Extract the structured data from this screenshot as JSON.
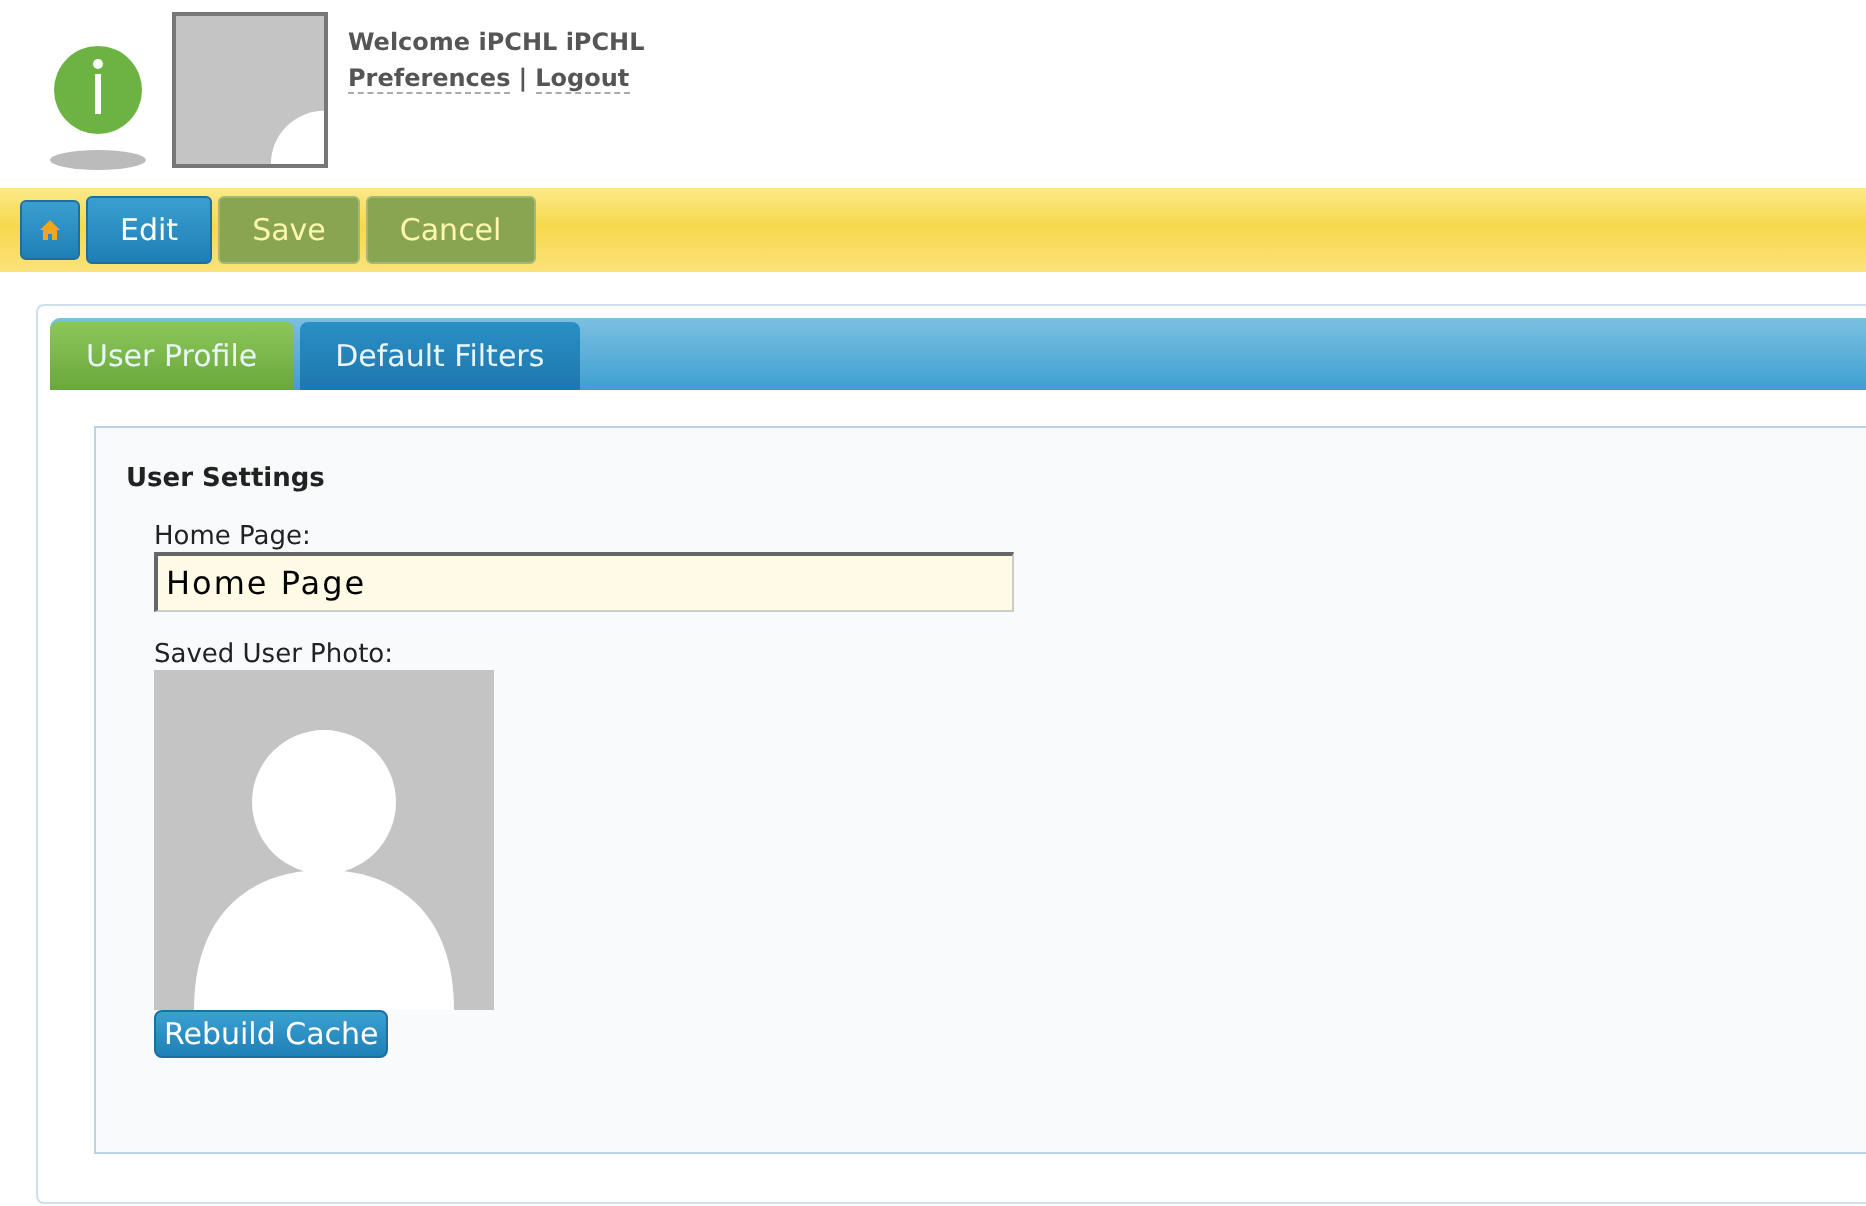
{
  "header": {
    "welcome": "Welcome iPCHL iPCHL",
    "links": [
      {
        "label": "Preferences"
      },
      {
        "label": "Logout"
      }
    ],
    "separator": "|"
  },
  "toolbar": {
    "buttons": [
      {
        "kind": "home",
        "disabled": false
      },
      {
        "kind": "text",
        "label": "Edit",
        "disabled": false
      },
      {
        "kind": "text",
        "label": "Save",
        "disabled": true
      },
      {
        "kind": "text",
        "label": "Cancel",
        "disabled": true
      }
    ]
  },
  "tabs": [
    {
      "label": "User Profile",
      "selected": true
    },
    {
      "label": "Default Filters",
      "selected": false
    }
  ],
  "section": {
    "title": "User Settings",
    "home_page": {
      "label": "Home Page:",
      "value": "Home Page"
    },
    "photo": {
      "label": "Saved User Photo:"
    },
    "button": "Rebuild Cache"
  }
}
